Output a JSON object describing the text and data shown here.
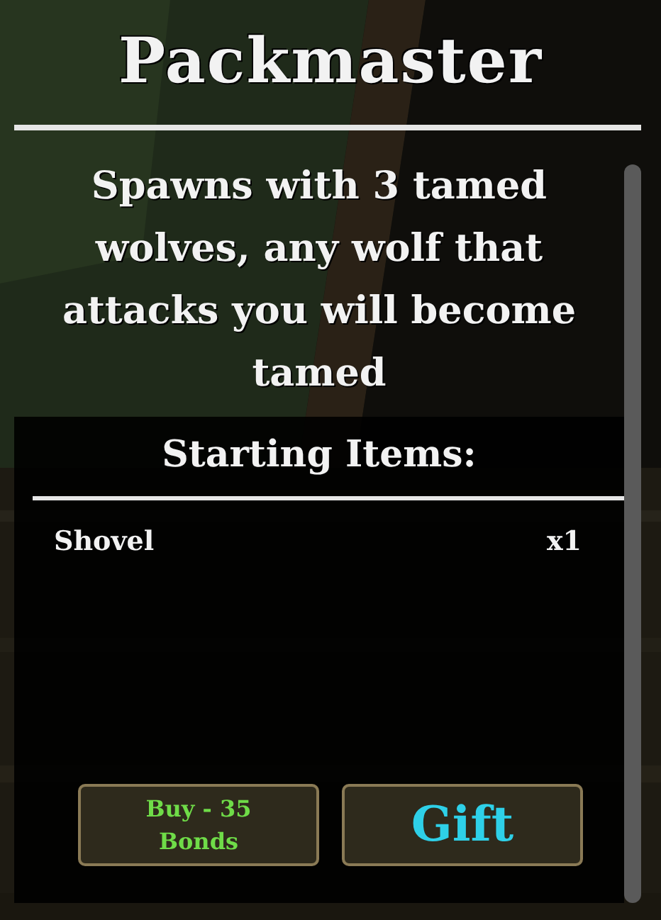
{
  "title": "Packmaster",
  "description": "Spawns with 3 tamed wolves, any wolf that attacks you will become tamed",
  "items_heading": "Starting Items:",
  "items": [
    {
      "name": "Shovel",
      "quantity": "x1"
    }
  ],
  "buttons": [
    {
      "label": "Buy - 35 Bonds",
      "kind": "buy"
    },
    {
      "label": "Gift",
      "kind": "gift"
    }
  ]
}
